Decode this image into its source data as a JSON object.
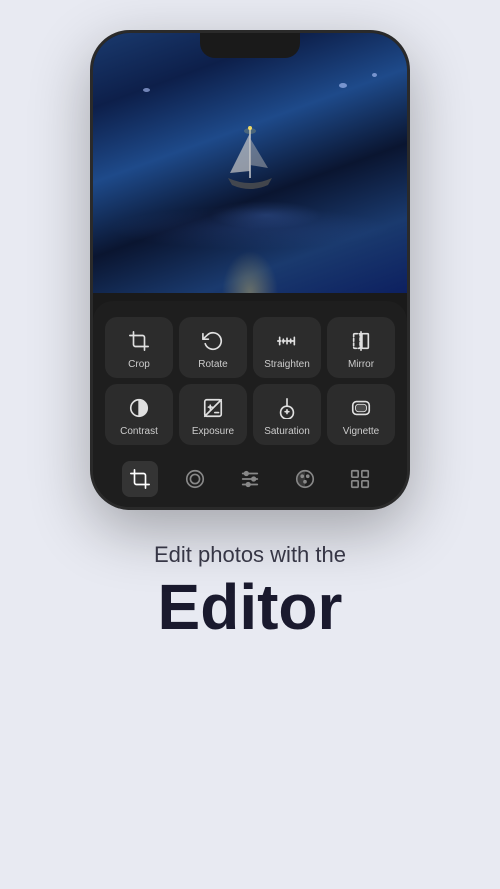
{
  "background_color": "#e8eaf2",
  "phone": {
    "tools": {
      "row1": [
        {
          "id": "crop",
          "label": "Crop"
        },
        {
          "id": "rotate",
          "label": "Rotate"
        },
        {
          "id": "straighten",
          "label": "Straighten"
        },
        {
          "id": "mirror",
          "label": "Mirror"
        }
      ],
      "row2": [
        {
          "id": "contrast",
          "label": "Contrast"
        },
        {
          "id": "exposure",
          "label": "Exposure"
        },
        {
          "id": "saturation",
          "label": "Saturation"
        },
        {
          "id": "vignette",
          "label": "Vignette"
        }
      ]
    },
    "nav": [
      {
        "id": "crop-nav",
        "active": true
      },
      {
        "id": "filter-nav",
        "active": false
      },
      {
        "id": "adjust-nav",
        "active": false
      },
      {
        "id": "color-nav",
        "active": false
      },
      {
        "id": "grid-nav",
        "active": false
      }
    ]
  },
  "text": {
    "subtitle": "Edit photos with the",
    "title": "Editor"
  }
}
